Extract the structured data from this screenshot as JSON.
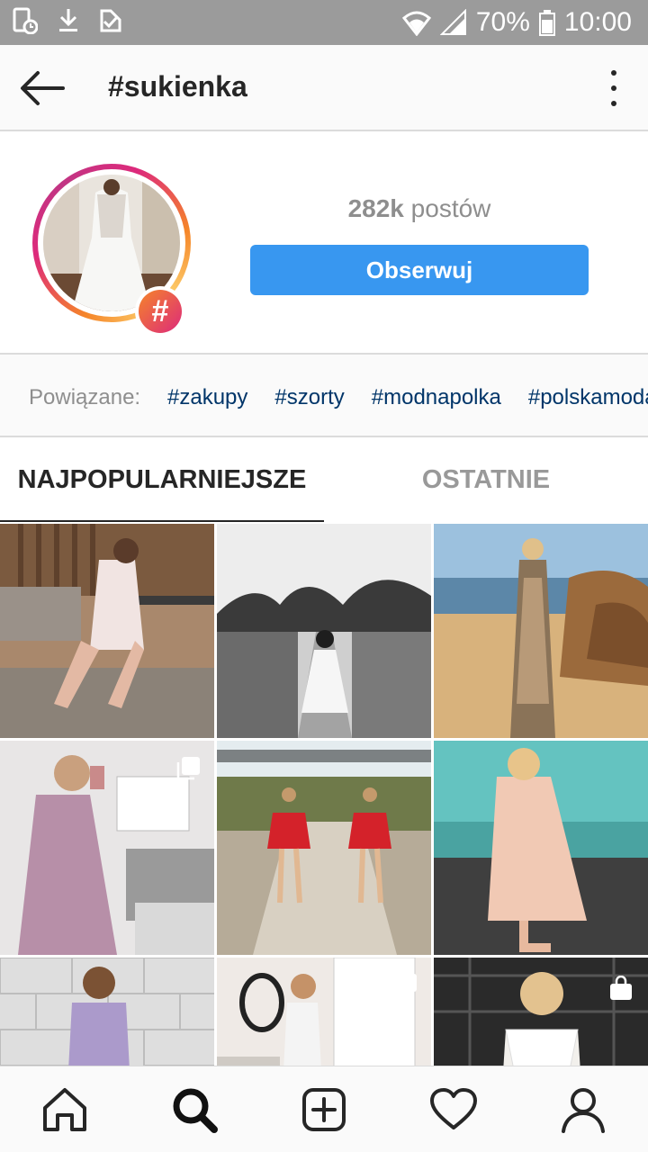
{
  "status_bar": {
    "battery": "70%",
    "time": "10:00"
  },
  "header": {
    "title": "#sukienka"
  },
  "profile": {
    "posts_count": "282k",
    "posts_label": "postów",
    "follow_label": "Obserwuj",
    "hash_symbol": "#"
  },
  "related": {
    "label": "Powiązane:",
    "tags": [
      "#zakupy",
      "#szorty",
      "#modnapolka",
      "#polskamoda"
    ]
  },
  "tabs": [
    {
      "label": "NAJPOPULARNIEJSZE",
      "active": true
    },
    {
      "label": "OSTATNIE",
      "active": false
    }
  ],
  "grid": {
    "posts": [
      {
        "name": "post-1",
        "palette": "warm-interior"
      },
      {
        "name": "post-2",
        "palette": "grayscale-road"
      },
      {
        "name": "post-3",
        "palette": "beach-rocks"
      },
      {
        "name": "post-4",
        "palette": "white-room",
        "badge": "multi-photo-icon"
      },
      {
        "name": "post-5",
        "palette": "red-dress-path"
      },
      {
        "name": "post-6",
        "palette": "sea-peach"
      },
      {
        "name": "post-7",
        "palette": "stone-wall"
      },
      {
        "name": "post-8",
        "palette": "white-mirror",
        "badge": "multi-photo-icon"
      },
      {
        "name": "post-9",
        "palette": "dark-lace",
        "badge": "shopping-bag-icon"
      }
    ]
  },
  "bottom_nav": [
    "home-icon",
    "search-icon",
    "add-post-icon",
    "activity-heart-icon",
    "profile-icon"
  ],
  "colors": {
    "accent": "#3897f0",
    "tag": "#003569",
    "muted": "#8e8e8e",
    "status_bar": "#9b9b9b"
  }
}
